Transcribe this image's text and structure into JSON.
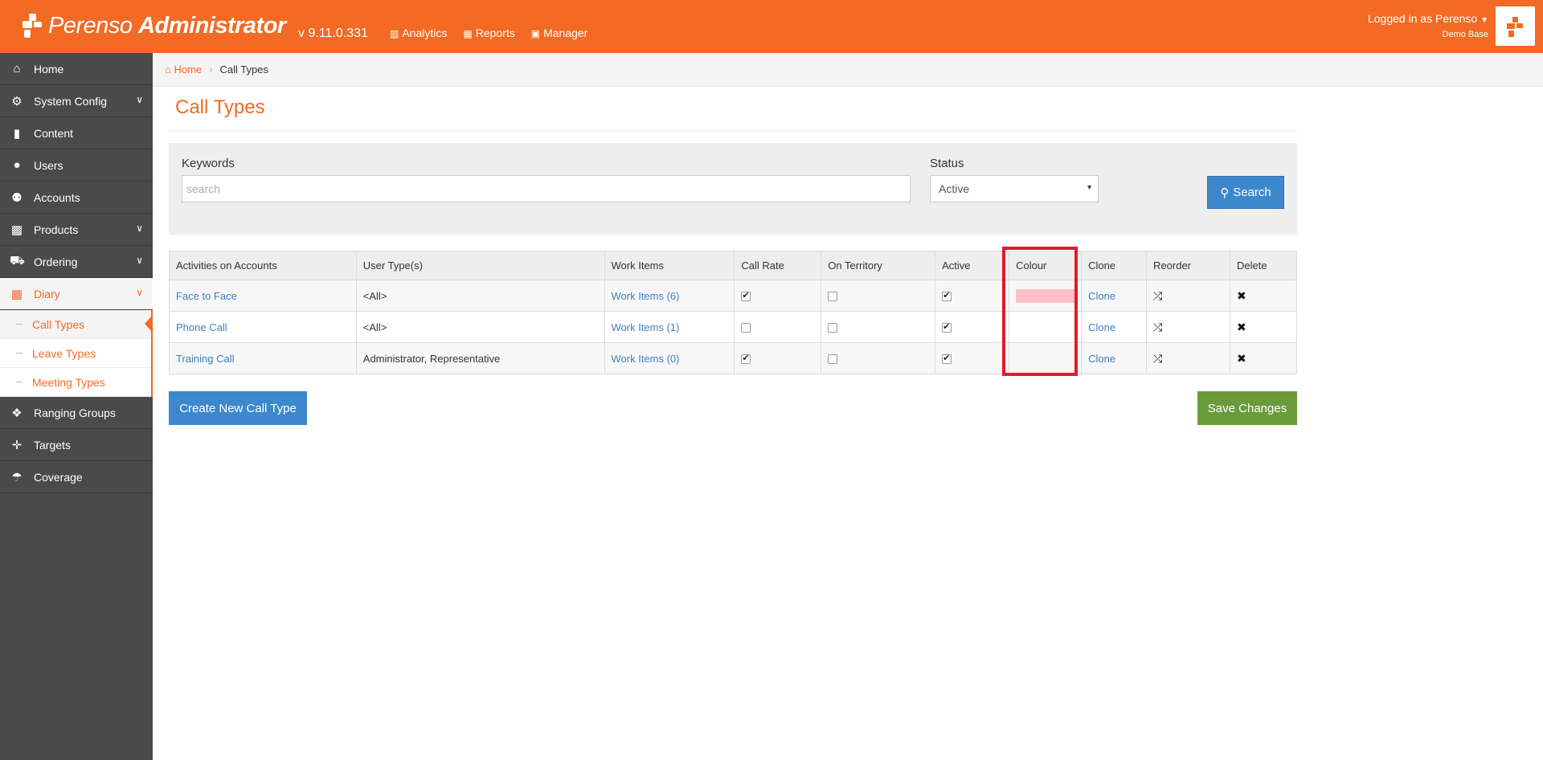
{
  "header": {
    "brand_light": "Perenso ",
    "brand_bold": "Administrator",
    "version": "v 9.11.0.331",
    "nav": [
      {
        "label": "Analytics",
        "icon": "chart-icon"
      },
      {
        "label": "Reports",
        "icon": "table-icon"
      },
      {
        "label": "Manager",
        "icon": "briefcase-icon"
      }
    ],
    "user_label": "Logged in as Perenso",
    "user_sub": "Demo Base"
  },
  "sidebar": {
    "items": [
      {
        "label": "Home",
        "icon": "home-icon"
      },
      {
        "label": "System Config",
        "icon": "gear-icon"
      },
      {
        "label": "Content",
        "icon": "file-icon"
      },
      {
        "label": "Users",
        "icon": "user-icon"
      },
      {
        "label": "Accounts",
        "icon": "users-icon"
      },
      {
        "label": "Products",
        "icon": "gift-icon"
      },
      {
        "label": "Ordering",
        "icon": "cart-icon"
      },
      {
        "label": "Diary",
        "icon": "calendar-icon"
      },
      {
        "label": "Ranging Groups",
        "icon": "cubes-icon"
      },
      {
        "label": "Targets",
        "icon": "crosshairs-icon"
      },
      {
        "label": "Coverage",
        "icon": "umbrella-icon"
      }
    ],
    "diary_sub": [
      "Call Types",
      "Leave Types",
      "Meeting Types"
    ]
  },
  "breadcrumb": {
    "home": "Home",
    "current": "Call Types"
  },
  "page_title": "Call Types",
  "search": {
    "keywords_label": "Keywords",
    "keywords_placeholder": "search",
    "status_label": "Status",
    "status_value": "Active",
    "button": "Search"
  },
  "table": {
    "headers": [
      "Activities on Accounts",
      "User Type(s)",
      "Work Items",
      "Call Rate",
      "On Territory",
      "Active",
      "Colour",
      "Clone",
      "Reorder",
      "Delete"
    ],
    "rows": [
      {
        "name": "Face to Face",
        "user_types": "<All>",
        "work_items": "Work Items (6)",
        "call_rate": true,
        "on_territory": false,
        "active": true,
        "colour": "#ffc0cb",
        "clone": "Clone"
      },
      {
        "name": "Phone Call",
        "user_types": "<All>",
        "work_items": "Work Items (1)",
        "call_rate": false,
        "on_territory": false,
        "active": true,
        "colour": "",
        "clone": "Clone"
      },
      {
        "name": "Training Call",
        "user_types": "Administrator, Representative",
        "work_items": "Work Items (0)",
        "call_rate": true,
        "on_territory": false,
        "active": true,
        "colour": "",
        "clone": "Clone"
      }
    ]
  },
  "buttons": {
    "create": "Create New Call Type",
    "save": "Save Changes"
  },
  "colors": {
    "brand": "#f26a24",
    "primary": "#3d88cc",
    "success": "#6a9b3a",
    "highlight": "#e11b2b"
  }
}
